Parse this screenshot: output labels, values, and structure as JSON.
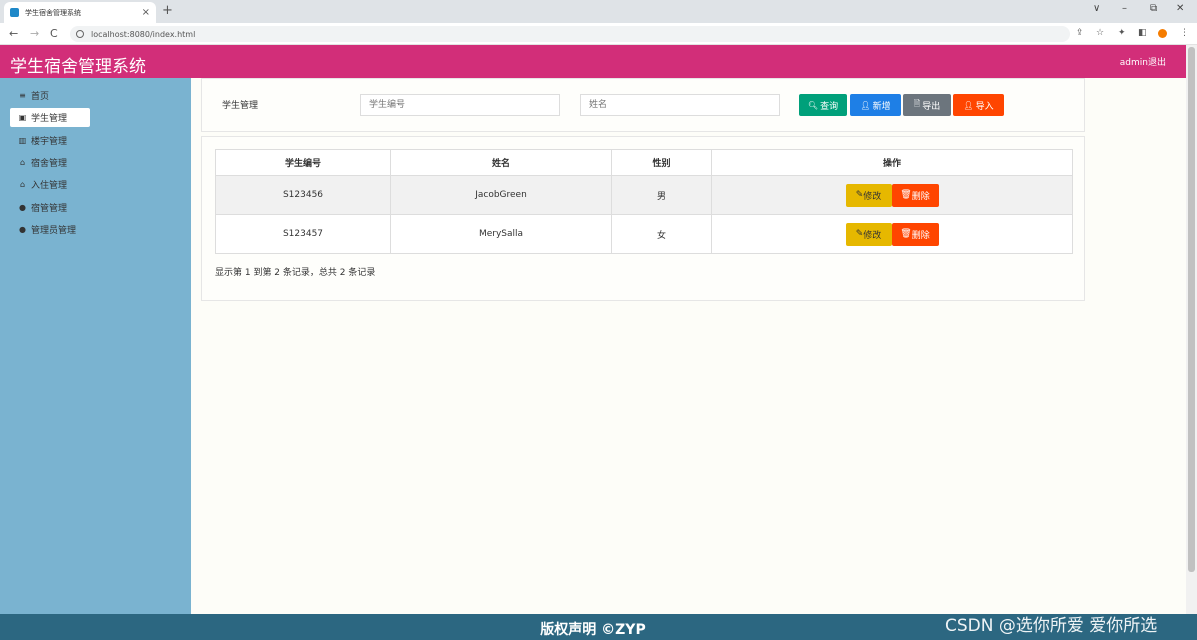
{
  "browser": {
    "tab_title": "学生宿舍管理系统",
    "tab_close": "×",
    "new_tab": "+",
    "url": "localhost:8080/index.html",
    "nav_back": "←",
    "nav_forward": "→",
    "nav_reload": "C",
    "minimize": "–",
    "maximize": "⧉",
    "close": "✕",
    "tab_dropdown": "∨"
  },
  "header": {
    "title": "学生宿舍管理系统",
    "user_text": "admin退出"
  },
  "sidebar": {
    "items": [
      {
        "icon": "≡",
        "label": "首页"
      },
      {
        "icon": "▣",
        "label": "学生管理"
      },
      {
        "icon": "▥",
        "label": "楼宇管理"
      },
      {
        "icon": "⌂",
        "label": "宿舍管理"
      },
      {
        "icon": "⌂",
        "label": "入住管理"
      },
      {
        "icon": "●",
        "label": "宿管管理"
      },
      {
        "icon": "●",
        "label": "管理员管理"
      }
    ]
  },
  "search": {
    "section_label": "学生管理",
    "id_placeholder": "学生编号",
    "name_placeholder": "姓名",
    "query_label": "查询",
    "add_label": "新增",
    "export_label": "导出",
    "import_label": "导入"
  },
  "table": {
    "headers": [
      "学生编号",
      "姓名",
      "性别",
      "操作"
    ],
    "rows": [
      {
        "id": "S123456",
        "name": "JacobGreen",
        "gender": "男"
      },
      {
        "id": "S123457",
        "name": "MerySalla",
        "gender": "女"
      }
    ],
    "edit_label": "修改",
    "delete_label": "删除",
    "pager_text": "显示第 1 到第 2 条记录，总共 2 条记录"
  },
  "footer": {
    "text": "版权声明 ©ZYP",
    "watermark": "CSDN @选你所爱 爱你所选"
  },
  "colors": {
    "header_bg": "#d22e79",
    "sidebar_bg": "#7ab3d0",
    "footer_bg": "#2c6781",
    "query_btn": "#00a07a",
    "add_btn": "#1e7fe6",
    "export_btn": "#6c757d",
    "import_btn": "#ff4500",
    "edit_btn": "#e6b800",
    "delete_btn": "#ff4500"
  }
}
